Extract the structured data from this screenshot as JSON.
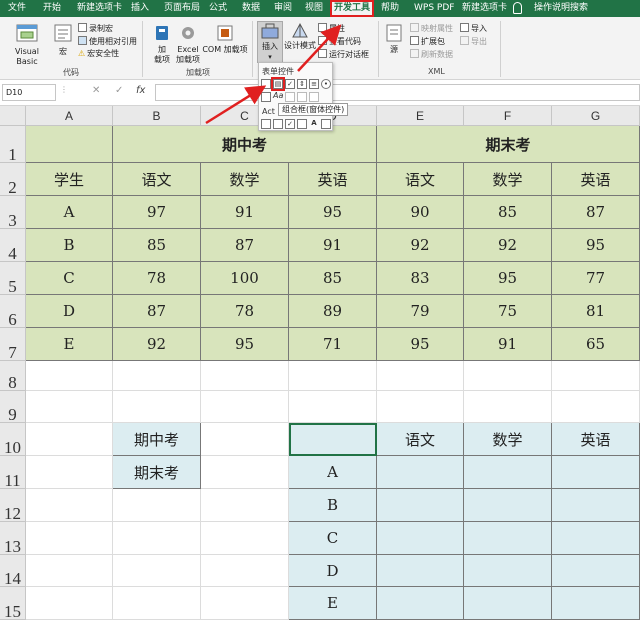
{
  "menu": {
    "tabs": [
      "文件",
      "开始",
      "新建选项卡",
      "插入",
      "页面布局",
      "公式",
      "数据",
      "审阅",
      "视图",
      "开发工具",
      "帮助",
      "WPS PDF",
      "新建选项卡",
      "操作说明搜索"
    ],
    "active": "开发工具"
  },
  "ribbon": {
    "code": {
      "visual_basic": "Visual Basic",
      "macro": "宏",
      "record_macro": "录制宏",
      "relative_ref": "使用相对引用",
      "macro_security": "宏安全性",
      "group_label": "代码"
    },
    "addins": {
      "addins": [
        "加",
        "载项"
      ],
      "excel_addins": [
        "Excel",
        "加载项"
      ],
      "com_addins": "COM 加载项",
      "group_label": "加载项"
    },
    "controls": {
      "insert": "插入",
      "design_mode": "设计模式",
      "properties": "属性",
      "view_code": "查看代码",
      "run_dialog": "运行对话框"
    },
    "xml": {
      "source": "源",
      "map_props": "映射属性",
      "expansion_packs": "扩展包",
      "refresh_data": "刷新数据",
      "import": "导入",
      "export": "导出",
      "group_label": "XML"
    }
  },
  "formula_bar": {
    "name_box": "D10",
    "cancel": "✕",
    "enter": "✓",
    "fx": "fx",
    "value": ""
  },
  "dropdown": {
    "form_controls_label": "表单控件",
    "activex_label": "Act",
    "activex_text_icon": "Aa",
    "activex_label_icon": "A",
    "tooltip": "组合框(窗体控件)"
  },
  "grid": {
    "columns": [
      "A",
      "B",
      "C",
      "D",
      "E",
      "F",
      "G"
    ],
    "rows": [
      "1",
      "2",
      "3",
      "4",
      "5",
      "6",
      "7",
      "8",
      "9",
      "10",
      "11",
      "12",
      "13",
      "14",
      "15"
    ],
    "midterm_header": "期中考",
    "final_header": "期末考",
    "subject_headers": [
      "学生",
      "语文",
      "数学",
      "英语",
      "语文",
      "数学",
      "英语"
    ],
    "students": [
      {
        "name": "A",
        "scores": [
          "97",
          "91",
          "95",
          "90",
          "85",
          "87"
        ]
      },
      {
        "name": "B",
        "scores": [
          "85",
          "87",
          "91",
          "92",
          "92",
          "95"
        ]
      },
      {
        "name": "C",
        "scores": [
          "78",
          "100",
          "85",
          "83",
          "95",
          "77"
        ]
      },
      {
        "name": "D",
        "scores": [
          "87",
          "78",
          "89",
          "79",
          "75",
          "81"
        ]
      },
      {
        "name": "E",
        "scores": [
          "92",
          "95",
          "71",
          "95",
          "91",
          "65"
        ]
      }
    ],
    "exam_list": [
      "期中考",
      "期末考"
    ],
    "query_headers": [
      "语文",
      "数学",
      "英语"
    ],
    "query_students": [
      "A",
      "B",
      "C",
      "D",
      "E"
    ]
  },
  "colors": {
    "title_bar": "#217346",
    "green_fill": "#d8e4bc",
    "blue_fill": "#dcedf1",
    "highlight": "#e02020"
  }
}
